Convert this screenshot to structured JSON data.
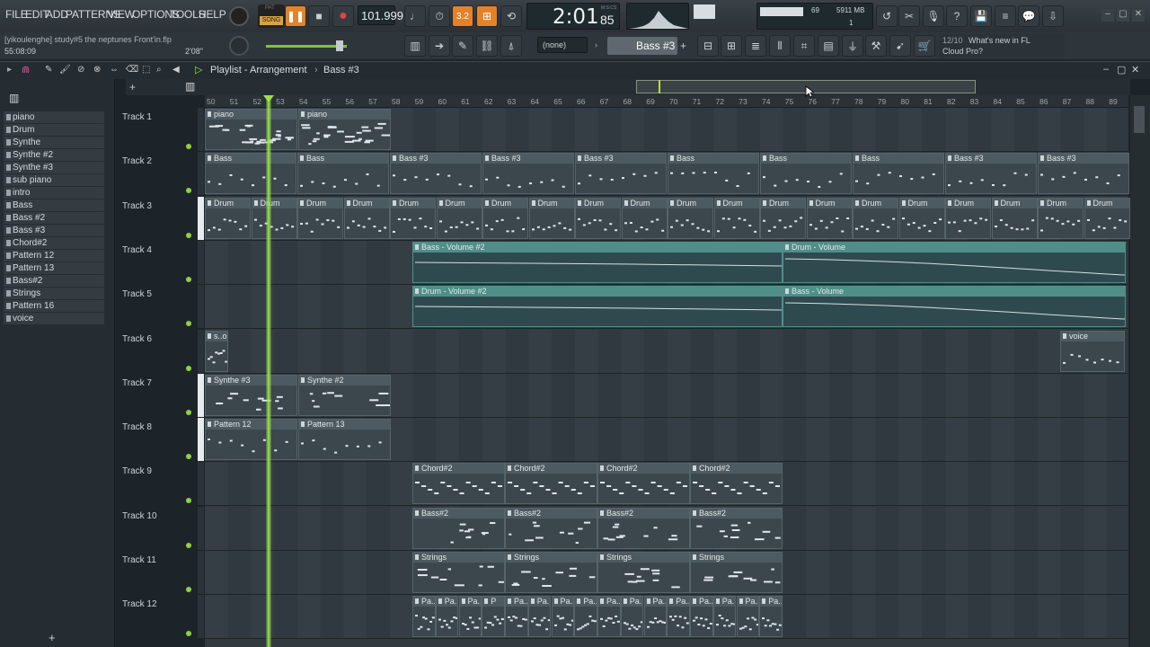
{
  "menu": [
    "FILE",
    "EDIT",
    "ADD",
    "PATTERNS",
    "VIEW",
    "OPTIONS",
    "TOOLS",
    "HELP"
  ],
  "transport": {
    "pat_label": "PAT",
    "song_label": "SONG",
    "tempo": "101.999",
    "time_big": "2:01",
    "time_small": "85",
    "time_unit": "M:S:CS",
    "pattern_num": "3.2"
  },
  "project": {
    "title": "[yikoulenghe] study#5 the neptunes Front'in.flp",
    "time": "55:08:09",
    "duration": "2'08\""
  },
  "monitor": {
    "cpu": "69",
    "mem": "5911 MB",
    "poly": "1"
  },
  "snap": {
    "value": "(none)"
  },
  "pattern_selector": {
    "value": "Bass #3",
    "add": "+"
  },
  "news": {
    "date": "12/10",
    "text1": "What's new in FL",
    "text2": "Cloud Pro?"
  },
  "playlist": {
    "title": "Playlist - Arrangement",
    "sep": "›",
    "pattern": "Bass #3"
  },
  "channels": [
    "piano",
    "Drum",
    "Synthe",
    "Synthe #2",
    "Synthe #3",
    "sub piano",
    "intro",
    "Bass",
    "Bass #2",
    "Bass #3",
    "Chord#2",
    "Pattern 12",
    "Pattern 13",
    "Bass#2",
    "Strings",
    "Pattern 16",
    "voice"
  ],
  "ruler": [
    "50",
    "51",
    "52",
    "53",
    "54",
    "55",
    "56",
    "57",
    "58",
    "59",
    "60",
    "61",
    "62",
    "63",
    "64",
    "65",
    "66",
    "67",
    "68",
    "69",
    "70",
    "71",
    "72",
    "73",
    "74",
    "75",
    "76",
    "77",
    "78",
    "79",
    "80",
    "81",
    "82",
    "83",
    "84",
    "85",
    "86",
    "87",
    "88",
    "89"
  ],
  "tracks": [
    "Track 1",
    "Track 2",
    "Track 3",
    "Track 4",
    "Track 5",
    "Track 6",
    "Track 7",
    "Track 8",
    "Track 9",
    "Track 10",
    "Track 11",
    "Track 12"
  ],
  "clips": {
    "t1": [
      "piano",
      "piano"
    ],
    "t2": [
      "Bass",
      "Bass",
      "Bass #3",
      "Bass #3",
      "Bass #3",
      "Bass",
      "Bass",
      "Bass",
      "Bass #3",
      "Bass #3"
    ],
    "t3": [
      "Drum",
      "Drum",
      "Drum",
      "Drum",
      "Drum",
      "Drum",
      "Drum",
      "Drum",
      "Drum",
      "Drum",
      "Drum",
      "Drum",
      "Drum",
      "Drum",
      "Drum",
      "Drum",
      "Drum",
      "Drum",
      "Drum",
      "Drum"
    ],
    "t4": [
      "Bass - Volume #2",
      "Drum - Volume"
    ],
    "t5": [
      "Drum - Volume #2",
      "Bass - Volume"
    ],
    "t6": [
      "s..o",
      "voice"
    ],
    "t7": [
      "Synthe #3",
      "Synthe #2"
    ],
    "t8": [
      "Pattern 12",
      "Pattern 13"
    ],
    "t9": [
      "Chord#2",
      "Chord#2",
      "Chord#2",
      "Chord#2"
    ],
    "t10": [
      "Bass#2",
      "Bass#2",
      "Bass#2",
      "Bass#2"
    ],
    "t11": [
      "Strings",
      "Strings",
      "Strings",
      "Strings"
    ],
    "t12": [
      "Pa...",
      "Pa...",
      "Pa...",
      "P",
      "Pa...",
      "Pa...",
      "Pa...",
      "Pa...",
      "Pa...",
      "Pa...",
      "Pa...",
      "Pa...",
      "Pa...",
      "Pa...",
      "Pa...",
      "Pa..."
    ]
  },
  "colors": {
    "accent": "#e4822a",
    "playhead": "#9be34a",
    "clip": "#3c464d",
    "auto_clip": "#4f8f88"
  }
}
